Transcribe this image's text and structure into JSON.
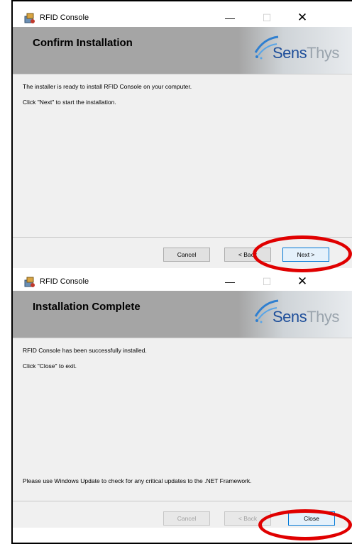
{
  "window1": {
    "title": "RFID Console",
    "header_title": "Confirm Installation",
    "logo": {
      "brand_a": "Sens",
      "brand_b": "Thys"
    },
    "line1": "The installer is ready to install RFID Console on your computer.",
    "line2": "Click \"Next\" to start the installation.",
    "cancel_label": "Cancel",
    "back_label": "< Back",
    "next_label": "Next >"
  },
  "window2": {
    "title": "RFID Console",
    "header_title": "Installation Complete",
    "logo": {
      "brand_a": "Sens",
      "brand_b": "Thys"
    },
    "line1": "RFID Console has been successfully installed.",
    "line2": "Click \"Close\" to exit.",
    "line3": "Please use Windows Update to check for any critical updates to the .NET Framework.",
    "cancel_label": "Cancel",
    "back_label": "< Back",
    "close_label": "Close"
  },
  "titlebar": {
    "minimize": "—",
    "maximize": "☐",
    "close": "✕"
  },
  "colors": {
    "header": "#a5a5a5",
    "body": "#f0f0f0",
    "annotation": "#e00000",
    "brand": "#1f4f9a"
  }
}
